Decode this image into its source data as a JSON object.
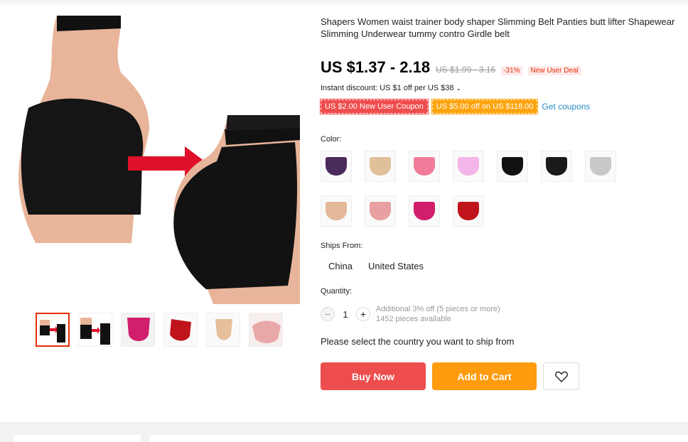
{
  "product": {
    "title": "Shapers Women waist trainer body shaper Slimming Belt Panties butt lifter Shapewear Slimming Underwear tummy contro Girdle belt",
    "price": "US $1.37 - 2.18",
    "original_price": "US $1.99 - 3.16",
    "discount": "-31%",
    "new_user_deal": "New User Deal",
    "instant_discount": "Instant discount: US $1 off per US $38",
    "coupon_red": "US $2.00 New User Coupon",
    "coupon_orange": "US $5.00 off on US $118.00",
    "get_coupons": "Get coupons"
  },
  "color": {
    "label": "Color:",
    "swatches": [
      {
        "name": "purple",
        "color": "#4a2a5a"
      },
      {
        "name": "nude",
        "color": "#e0c09a"
      },
      {
        "name": "pink",
        "color": "#f07c9a"
      },
      {
        "name": "light-pink",
        "color": "#f4b6e8"
      },
      {
        "name": "black",
        "color": "#111111"
      },
      {
        "name": "black-lace",
        "color": "#1a1a1a"
      },
      {
        "name": "gray",
        "color": "#c8c8c8"
      },
      {
        "name": "skin",
        "color": "#e3b89a"
      },
      {
        "name": "peach",
        "color": "#e8a0a0"
      },
      {
        "name": "rose",
        "color": "#d21e6c"
      },
      {
        "name": "red",
        "color": "#c0141c"
      }
    ]
  },
  "ships_from": {
    "label": "Ships From:",
    "options": [
      "China",
      "United States"
    ]
  },
  "quantity": {
    "label": "Quantity:",
    "value": "1",
    "additional": "Additional 3% off (5 pieces or more)",
    "available": "1452 pieces available"
  },
  "ship_message": "Please select the country you want to ship from",
  "actions": {
    "buy_now": "Buy Now",
    "add_to_cart": "Add to Cart"
  },
  "icons": {
    "wishlist": "heart-icon",
    "minus": "minus-icon",
    "plus": "plus-icon",
    "chevron": "chevron-down-icon"
  },
  "colors": {
    "accent_red": "#ee4d4d",
    "accent_orange": "#fe9b0e",
    "link_blue": "#2a8ec7"
  }
}
